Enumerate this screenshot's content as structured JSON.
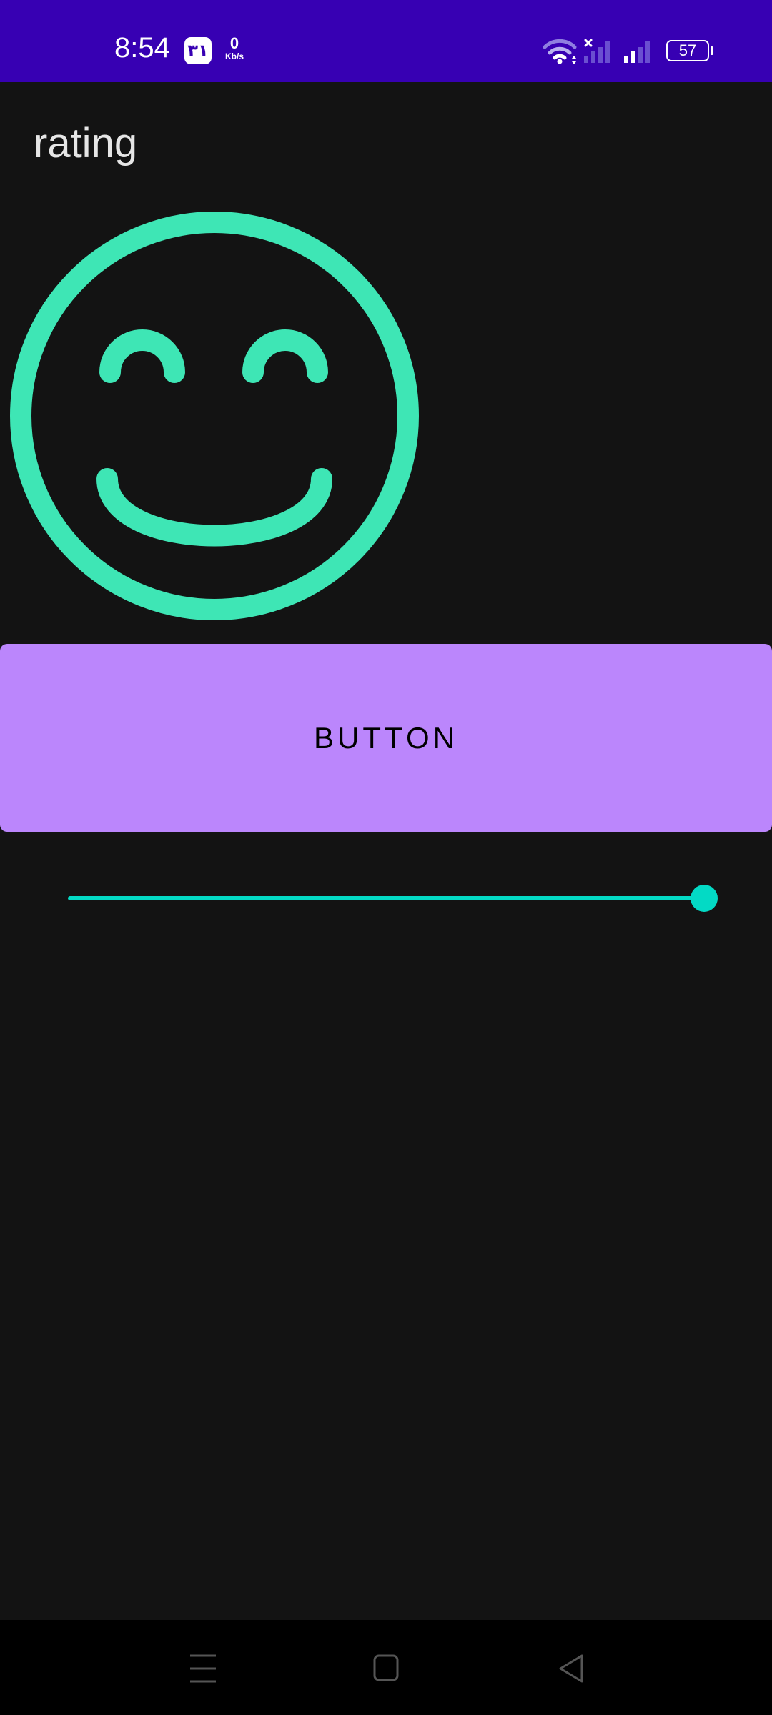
{
  "status_bar": {
    "time": "8:54",
    "calendar_badge": "٣١",
    "net_speed_value": "0",
    "net_speed_unit": "Kb/s",
    "battery_level": "57",
    "background_color": "#3700b3",
    "icons": [
      "wifi-icon",
      "signal-no-sim-icon",
      "signal-icon",
      "battery-icon"
    ]
  },
  "page": {
    "title": "rating",
    "background_color": "#131313"
  },
  "rating_face": {
    "icon": "smiley-icon",
    "color": "#3ee6b5"
  },
  "button": {
    "label": "BUTTON",
    "color": "#bb86fc"
  },
  "slider": {
    "value_fraction": 1.0,
    "color": "#03dac5"
  },
  "nav_bar": {
    "items": [
      "menu-icon",
      "home-icon",
      "back-icon"
    ]
  }
}
